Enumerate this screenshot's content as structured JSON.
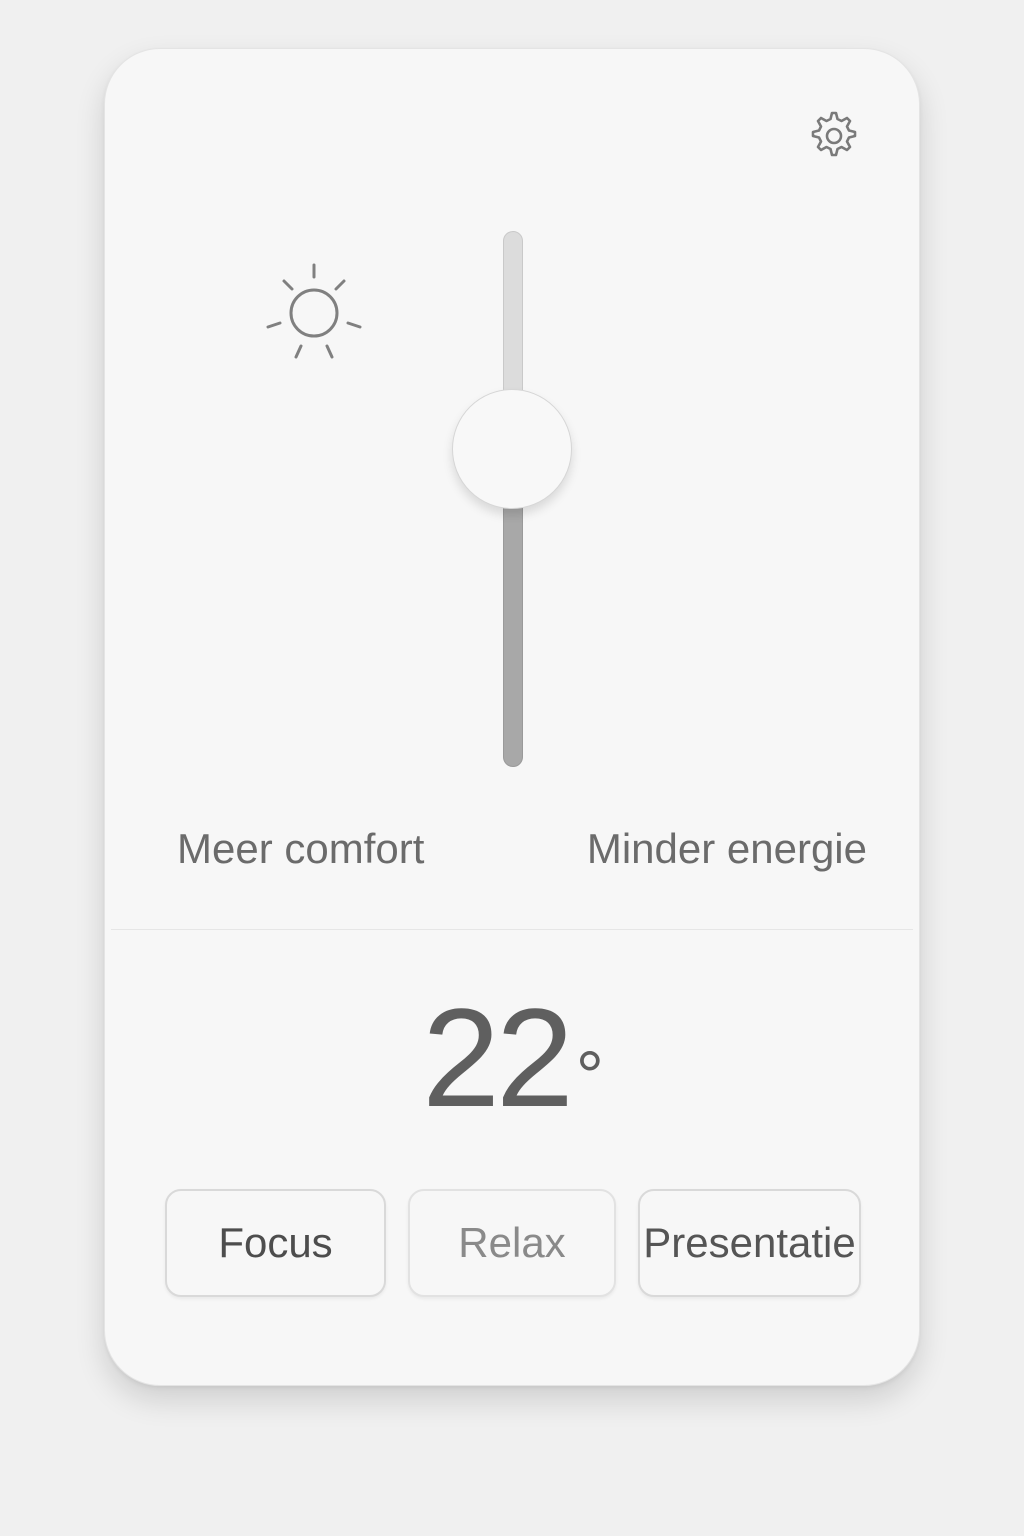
{
  "slider": {
    "value_fraction": 0.6,
    "left_label": "Meer comfort",
    "right_label": "Minder energie"
  },
  "temperature": {
    "value": "22",
    "unit": "°"
  },
  "presets": [
    {
      "label": "Focus"
    },
    {
      "label": "Relax"
    },
    {
      "label": "Presentatie"
    }
  ],
  "icons": {
    "settings": "gear-icon",
    "brightness": "sun-icon"
  },
  "colors": {
    "card": "#f7f7f7",
    "track_upper": "#dcdcdc",
    "track_lower": "#a8a8a8",
    "text": "#6b6b6b"
  }
}
